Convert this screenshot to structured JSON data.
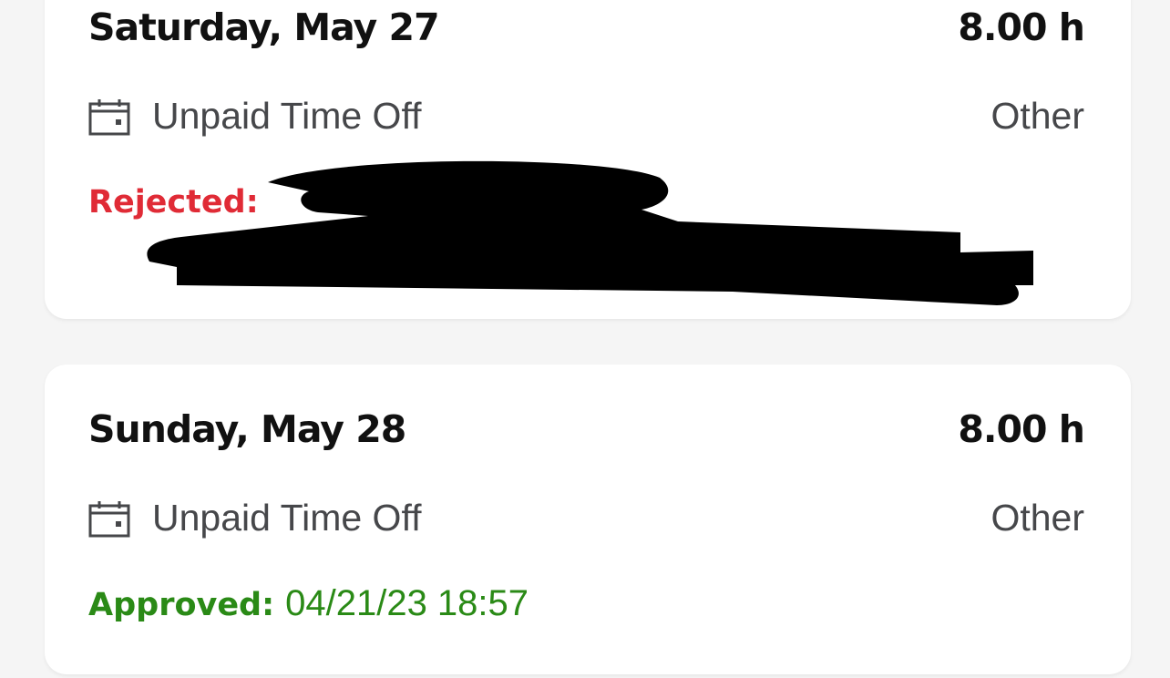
{
  "entries": [
    {
      "date": "Saturday, May 27",
      "hours": "8.00 h",
      "type_icon": "calendar-icon",
      "type": "Unpaid Time Off",
      "category": "Other",
      "status_label": "Rejected:",
      "status_value": "",
      "status_color": "#e02b36"
    },
    {
      "date": "Sunday, May 28",
      "hours": "8.00 h",
      "type_icon": "calendar-icon",
      "type": "Unpaid Time Off",
      "category": "Other",
      "status_label": "Approved:",
      "status_value": "04/21/23 18:57",
      "status_color": "#2a8a16"
    }
  ]
}
